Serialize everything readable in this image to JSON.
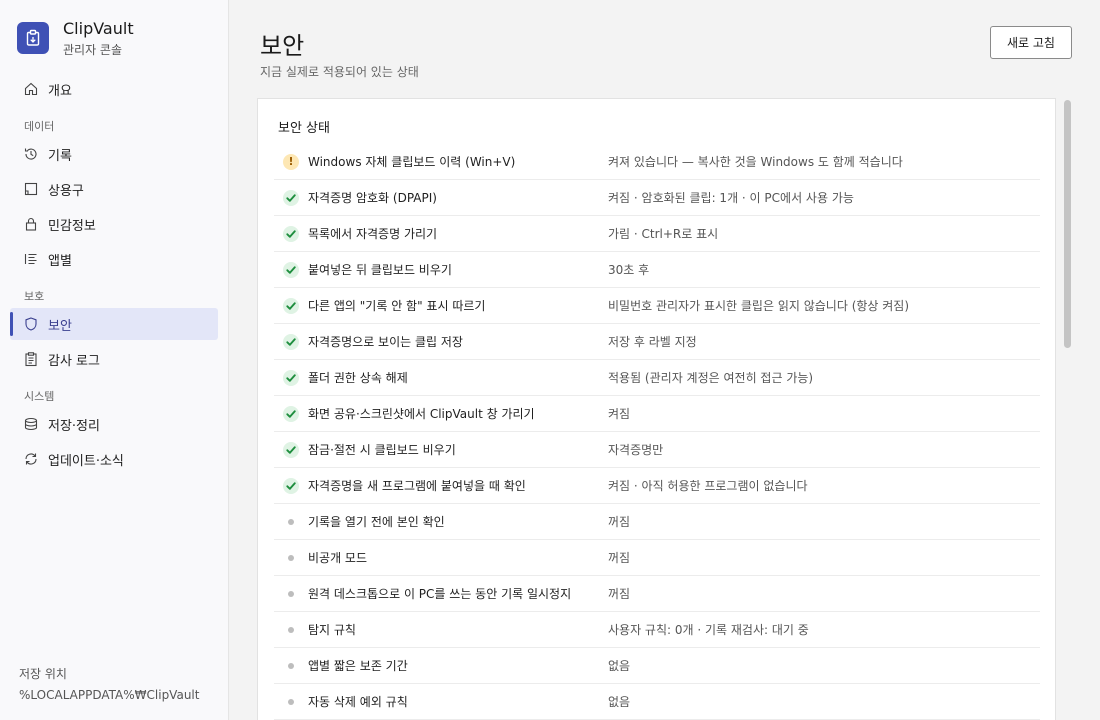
{
  "app": {
    "name": "ClipVault",
    "subtitle": "관리자 콘솔"
  },
  "nav": {
    "overview": "개요",
    "section_data": "데이터",
    "history": "기록",
    "snippets": "상용구",
    "sensitive": "민감정보",
    "per_app": "앱별",
    "section_protection": "보호",
    "security": "보안",
    "audit_log": "감사 로그",
    "section_system": "시스템",
    "storage_cleanup": "저장·정리",
    "updates_news": "업데이트·소식"
  },
  "storage": {
    "label": "저장 위치",
    "path": "%LOCALAPPDATA%₩ClipVault"
  },
  "page": {
    "title": "보안",
    "subtitle": "지금 실제로 적용되어 있는 상태",
    "refresh_label": "새로 고침"
  },
  "card": {
    "title": "보안 상태",
    "rows": [
      {
        "status": "warn",
        "label": "Windows 자체 클립보드 이력 (Win+V)",
        "value": "켜져 있습니다 — 복사한 것을 Windows 도 함께 적습니다"
      },
      {
        "status": "ok",
        "label": "자격증명 암호화 (DPAPI)",
        "value": "켜짐 · 암호화된 클립: 1개 · 이 PC에서 사용 가능"
      },
      {
        "status": "ok",
        "label": "목록에서 자격증명 가리기",
        "value": "가림 · Ctrl+R로 표시"
      },
      {
        "status": "ok",
        "label": "붙여넣은 뒤 클립보드 비우기",
        "value": "30초 후"
      },
      {
        "status": "ok",
        "label": "다른 앱의 \"기록 안 함\" 표시 따르기",
        "value": "비밀번호 관리자가 표시한 클립은 읽지 않습니다 (항상 켜짐)"
      },
      {
        "status": "ok",
        "label": "자격증명으로 보이는 클립 저장",
        "value": "저장 후 라벨 지정"
      },
      {
        "status": "ok",
        "label": "폴더 권한 상속 해제",
        "value": "적용됨 (관리자 계정은 여전히 접근 가능)"
      },
      {
        "status": "ok",
        "label": "화면 공유·스크린샷에서 ClipVault 창 가리기",
        "value": "켜짐"
      },
      {
        "status": "ok",
        "label": "잠금·절전 시 클립보드 비우기",
        "value": "자격증명만"
      },
      {
        "status": "ok",
        "label": "자격증명을 새 프로그램에 붙여넣을 때 확인",
        "value": "켜짐 · 아직 허용한 프로그램이 없습니다"
      },
      {
        "status": "off",
        "label": "기록을 열기 전에 본인 확인",
        "value": "꺼짐"
      },
      {
        "status": "off",
        "label": "비공개 모드",
        "value": "꺼짐"
      },
      {
        "status": "off",
        "label": "원격 데스크톱으로 이 PC를 쓰는 동안 기록 일시정지",
        "value": "꺼짐"
      },
      {
        "status": "off",
        "label": "탐지 규칙",
        "value": "사용자 규칙: 0개 · 기록 재검사: 대기 중"
      },
      {
        "status": "off",
        "label": "앱별 짧은 보존 기간",
        "value": "없음"
      },
      {
        "status": "off",
        "label": "자동 삭제 예외 규칙",
        "value": "없음"
      }
    ]
  },
  "colors": {
    "accent": "#3f51b5",
    "ok": "#1e8e3e",
    "warn": "#f9c74f",
    "off": "#bdbdbd"
  }
}
